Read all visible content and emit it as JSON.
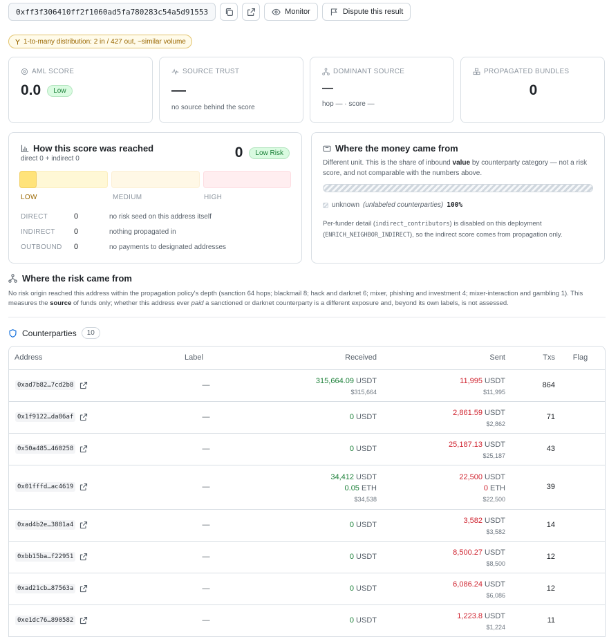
{
  "header": {
    "address": "0xff3f306410ff2f1060ad5fa780283c54a5d91553",
    "monitor_label": "Monitor",
    "dispute_label": "Dispute this result"
  },
  "pattern_chip": "1-to-many distribution: 2 in / 427 out, ~similar volume",
  "stats": {
    "aml": {
      "label": "AML SCORE",
      "value": "0.0",
      "badge": "Low"
    },
    "trust": {
      "label": "SOURCE TRUST",
      "value": "—",
      "sub": "no source behind the score"
    },
    "dominant": {
      "label": "DOMINANT SOURCE",
      "value": "—",
      "sub": "hop — · score —"
    },
    "bundles": {
      "label": "PROPAGATED BUNDLES",
      "value": "0"
    }
  },
  "score_panel": {
    "title": "How this score was reached",
    "subtitle": "direct 0 + indirect 0",
    "score": "0",
    "badge": "Low Risk",
    "scale_labels": [
      "LOW",
      "MEDIUM",
      "HIGH"
    ],
    "rows": [
      {
        "label": "DIRECT",
        "value": "0",
        "desc": "no risk seed on this address itself"
      },
      {
        "label": "INDIRECT",
        "value": "0",
        "desc": "nothing propagated in"
      },
      {
        "label": "OUTBOUND",
        "value": "0",
        "desc": "no payments to designated addresses"
      }
    ]
  },
  "money_panel": {
    "title": "Where the money came from",
    "desc_pre": "Different unit. This is the share of inbound ",
    "desc_bold": "value",
    "desc_post": " by counterparty category — not a risk score, and not comparable with the numbers above.",
    "legend_name": "unknown",
    "legend_note": "(unlabeled counterparties)",
    "legend_pct": "100%",
    "note_pre": "Per-funder detail (",
    "note_code1": "indirect_contributors",
    "note_mid": ") is disabled on this deployment (",
    "note_code2": "ENRICH_NEIGHBOR_INDIRECT",
    "note_post": "), so the indirect score comes from propagation only."
  },
  "risk_section": {
    "title": "Where the risk came from",
    "desc1": "No risk origin reached this address within the propagation policy's depth (sanction 64 hops; blackmail 8; hack and darknet 6; mixer, phishing and investment 4; mixer-interaction and gambling 1). This measures the ",
    "desc_bold": "source",
    "desc2": " of funds only; whether this address ever ",
    "desc_italic": "paid",
    "desc3": " a sanctioned or darknet counterparty is a different exposure and, beyond its own labels, is not assessed."
  },
  "counterparties": {
    "title": "Counterparties",
    "count": "10",
    "columns": [
      "Address",
      "Label",
      "Received",
      "Sent",
      "Txs",
      "Flag"
    ],
    "rows": [
      {
        "address": "0xad7b82…7cd2b8",
        "label": "—",
        "received": [
          {
            "amt": "315,664.09",
            "unit": "USDT"
          }
        ],
        "received_usd": "$315,664",
        "sent": [
          {
            "amt": "11,995",
            "unit": "USDT"
          }
        ],
        "sent_usd": "$11,995",
        "txs": "864"
      },
      {
        "address": "0x1f9122…da86af",
        "label": "—",
        "received": [
          {
            "amt": "0",
            "unit": "USDT"
          }
        ],
        "received_usd": "",
        "sent": [
          {
            "amt": "2,861.59",
            "unit": "USDT"
          }
        ],
        "sent_usd": "$2,862",
        "txs": "71"
      },
      {
        "address": "0x50a485…460258",
        "label": "—",
        "received": [
          {
            "amt": "0",
            "unit": "USDT"
          }
        ],
        "received_usd": "",
        "sent": [
          {
            "amt": "25,187.13",
            "unit": "USDT"
          }
        ],
        "sent_usd": "$25,187",
        "txs": "43"
      },
      {
        "address": "0x01fffd…ac4619",
        "label": "—",
        "received": [
          {
            "amt": "34,412",
            "unit": "USDT"
          },
          {
            "amt": "0.05",
            "unit": "ETH"
          }
        ],
        "received_usd": "$34,538",
        "sent": [
          {
            "amt": "22,500",
            "unit": "USDT"
          },
          {
            "amt": "0",
            "unit": "ETH"
          }
        ],
        "sent_usd": "$22,500",
        "txs": "39"
      },
      {
        "address": "0xad4b2e…3881a4",
        "label": "—",
        "received": [
          {
            "amt": "0",
            "unit": "USDT"
          }
        ],
        "received_usd": "",
        "sent": [
          {
            "amt": "3,582",
            "unit": "USDT"
          }
        ],
        "sent_usd": "$3,582",
        "txs": "14"
      },
      {
        "address": "0xbb15ba…f22951",
        "label": "—",
        "received": [
          {
            "amt": "0",
            "unit": "USDT"
          }
        ],
        "received_usd": "",
        "sent": [
          {
            "amt": "8,500.27",
            "unit": "USDT"
          }
        ],
        "sent_usd": "$8,500",
        "txs": "12"
      },
      {
        "address": "0xad21cb…87563a",
        "label": "—",
        "received": [
          {
            "amt": "0",
            "unit": "USDT"
          }
        ],
        "received_usd": "",
        "sent": [
          {
            "amt": "6,086.24",
            "unit": "USDT"
          }
        ],
        "sent_usd": "$6,086",
        "txs": "12"
      },
      {
        "address": "0xe1dc76…890582",
        "label": "—",
        "received": [
          {
            "amt": "0",
            "unit": "USDT"
          }
        ],
        "received_usd": "",
        "sent": [
          {
            "amt": "1,223.8",
            "unit": "USDT"
          }
        ],
        "sent_usd": "$1,224",
        "txs": "11"
      }
    ]
  },
  "colors": {
    "received": "#1a7f37",
    "sent": "#cf222e",
    "low": "#fff3c4",
    "medium": "#fff8e1",
    "high": "#ffebee"
  }
}
